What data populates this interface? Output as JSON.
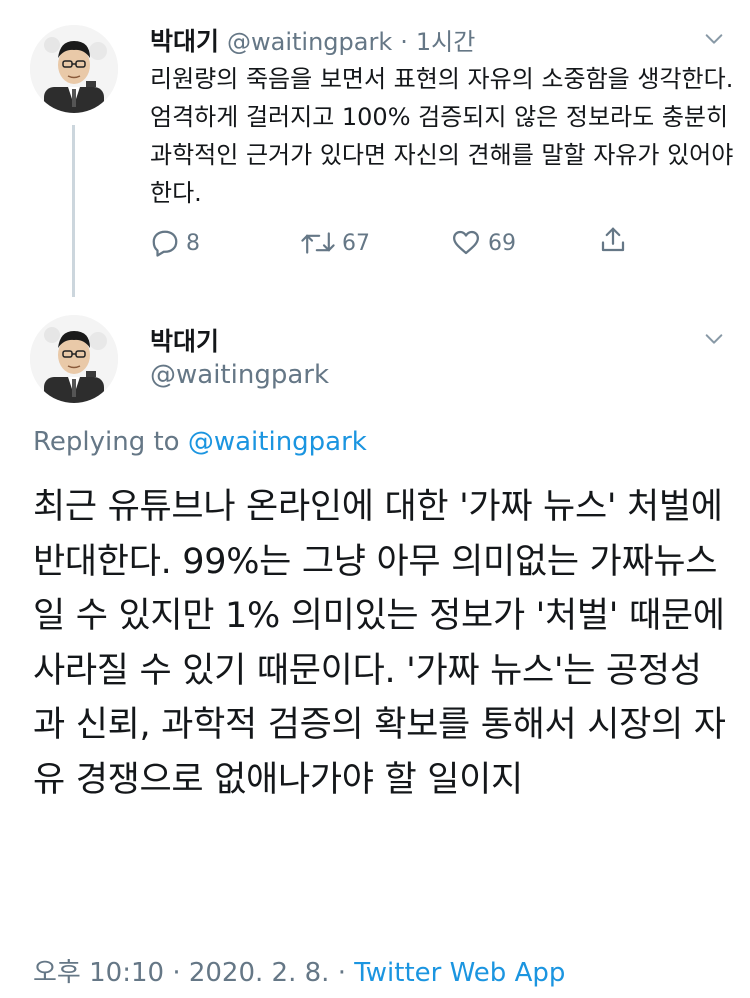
{
  "tweet1": {
    "name": "박대기",
    "handle": "@waitingpark",
    "separator": "·",
    "time": "1시간",
    "text": "리원량의 죽음을 보면서 표현의 자유의 소중함을 생각한다. 엄격하게 걸러지고 100% 검증되지 않은 정보라도 충분히 과학적인 근거가 있다면 자신의 견해를 말할 자유가 있어야 한다.",
    "replies": "8",
    "retweets": "67",
    "likes": "69"
  },
  "tweet2": {
    "name": "박대기",
    "handle": "@waitingpark",
    "replying_prefix": "Replying to",
    "replying_handle": "@waitingpark",
    "text": "최근 유튜브나 온라인에 대한 '가짜 뉴스' 처벌에 반대한다. 99%는 그냥 아무 의미없는 가짜뉴스일 수 있지만 1% 의미있는 정보가 '처벌' 때문에 사라질 수 있기 때문이다. '가짜 뉴스'는 공정성과 신뢰, 과학적 검증의 확보를 통해서 시장의 자유 경쟁으로 없애나가야 할 일이지",
    "time": "오후 10:10",
    "sep1": "·",
    "date": "2020. 2. 8.",
    "sep2": "·",
    "source": "Twitter Web App"
  },
  "colors": {
    "text": "#14171a",
    "muted": "#657786",
    "link": "#1b95e0",
    "thread_line": "#ccd6dd"
  },
  "icons": [
    "avatar",
    "chevron-down-icon",
    "reply-icon",
    "retweet-icon",
    "like-icon",
    "share-icon"
  ]
}
